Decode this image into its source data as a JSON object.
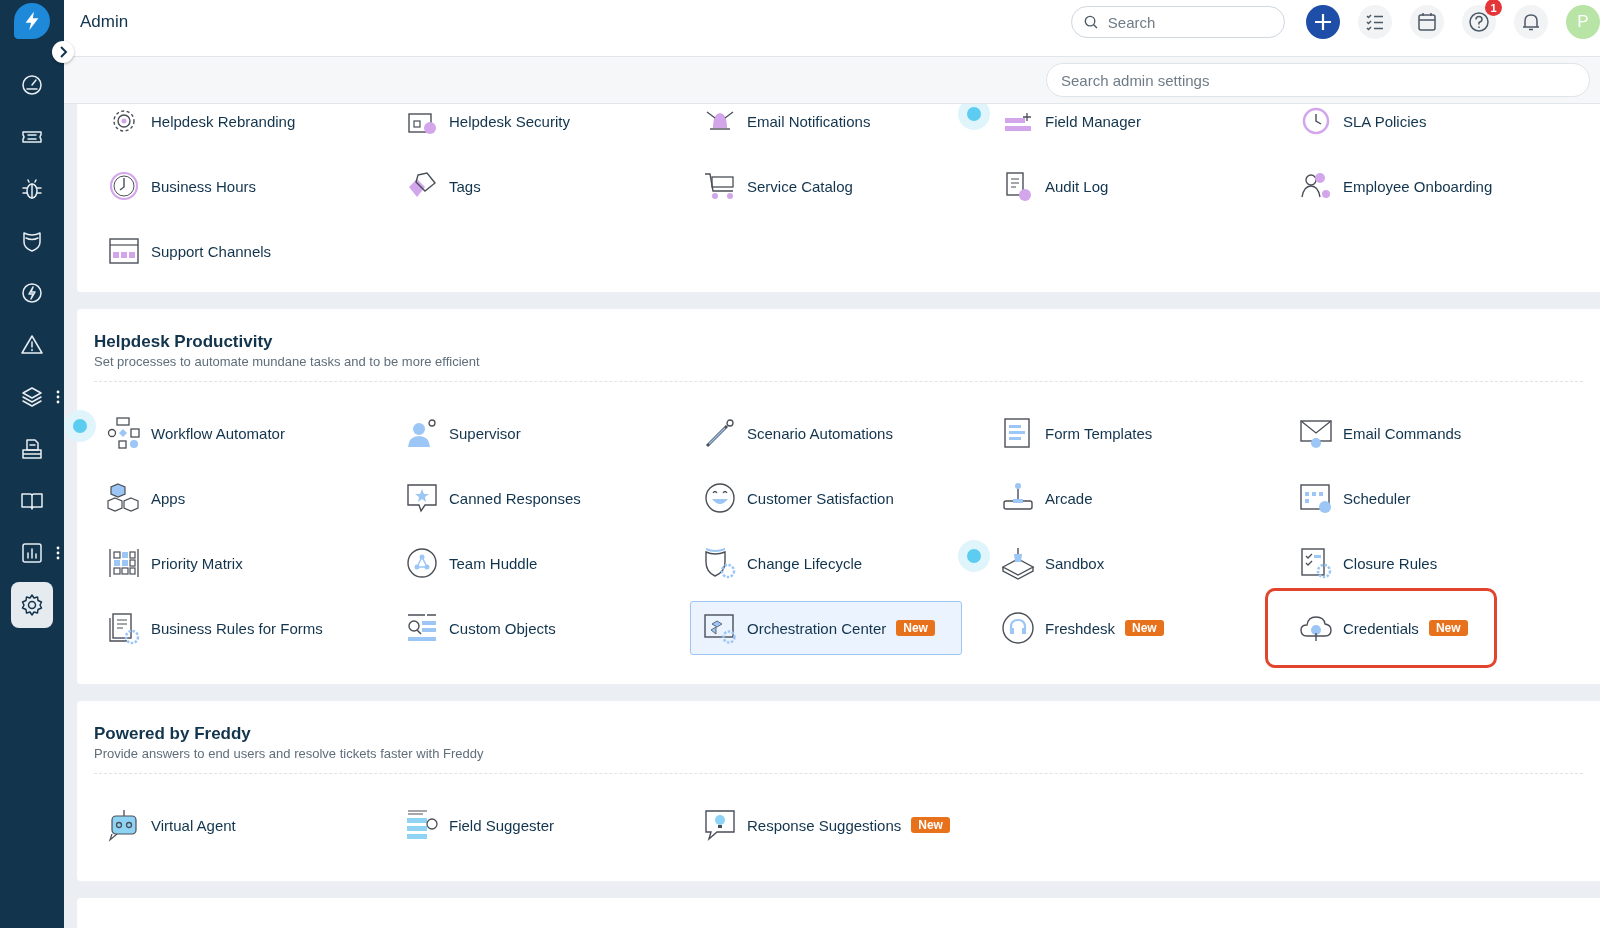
{
  "sidebar": {
    "items": [
      {
        "selected": false,
        "more": false
      },
      {
        "selected": false,
        "more": false
      },
      {
        "selected": false,
        "more": false
      },
      {
        "selected": false,
        "more": false
      },
      {
        "selected": false,
        "more": false
      },
      {
        "selected": false,
        "more": false
      },
      {
        "selected": false,
        "more": true
      },
      {
        "selected": false,
        "more": false
      },
      {
        "selected": false,
        "more": false
      },
      {
        "selected": false,
        "more": true
      },
      {
        "selected": true,
        "more": false
      }
    ]
  },
  "header": {
    "title": "Admin",
    "search": {
      "placeholder": "Search"
    },
    "help_badge": "1",
    "avatar": "P"
  },
  "admin_search": {
    "placeholder": "Search admin settings"
  },
  "sections": [
    {
      "items": [
        {
          "label": "Helpdesk Rebranding",
          "beacon": false
        },
        {
          "label": "Helpdesk Security",
          "beacon": false
        },
        {
          "label": "Email Notifications",
          "beacon": false
        },
        {
          "label": "Field Manager",
          "beacon": true
        },
        {
          "label": "SLA Policies",
          "beacon": false
        },
        {
          "label": "Business Hours",
          "beacon": false
        },
        {
          "label": "Tags",
          "beacon": false
        },
        {
          "label": "Service Catalog",
          "beacon": false
        },
        {
          "label": "Audit Log",
          "beacon": false
        },
        {
          "label": "Employee Onboarding",
          "beacon": false
        },
        {
          "label": "Support Channels",
          "beacon": false
        }
      ]
    },
    {
      "title": "Helpdesk Productivity",
      "subtitle": "Set processes to automate mundane tasks and to be more efficient",
      "items": [
        {
          "label": "Workflow Automator",
          "beacon": true,
          "hovered": false,
          "outlined": false
        },
        {
          "label": "Supervisor",
          "beacon": false,
          "hovered": false,
          "outlined": false
        },
        {
          "label": "Scenario Automations",
          "beacon": false,
          "hovered": false,
          "outlined": false
        },
        {
          "label": "Form Templates",
          "beacon": false,
          "hovered": false,
          "outlined": false
        },
        {
          "label": "Email Commands",
          "beacon": false,
          "hovered": false,
          "outlined": false
        },
        {
          "label": "Apps",
          "beacon": false,
          "hovered": false,
          "outlined": false
        },
        {
          "label": "Canned Responses",
          "beacon": false,
          "hovered": false,
          "outlined": false
        },
        {
          "label": "Customer Satisfaction",
          "beacon": false,
          "hovered": false,
          "outlined": false
        },
        {
          "label": "Arcade",
          "beacon": false,
          "hovered": false,
          "outlined": false
        },
        {
          "label": "Scheduler",
          "beacon": false,
          "hovered": false,
          "outlined": false
        },
        {
          "label": "Priority Matrix",
          "beacon": false,
          "hovered": false,
          "outlined": false
        },
        {
          "label": "Team Huddle",
          "beacon": false,
          "hovered": false,
          "outlined": false
        },
        {
          "label": "Change Lifecycle",
          "beacon": false,
          "hovered": false,
          "outlined": false
        },
        {
          "label": "Sandbox",
          "beacon": true,
          "hovered": false,
          "outlined": false
        },
        {
          "label": "Closure Rules",
          "beacon": false,
          "hovered": false,
          "outlined": false
        },
        {
          "label": "Business Rules for Forms",
          "beacon": false,
          "hovered": false,
          "outlined": false
        },
        {
          "label": "Custom Objects",
          "beacon": false,
          "hovered": false,
          "outlined": false
        },
        {
          "label": "Orchestration Center",
          "badge": "New",
          "beacon": false,
          "hovered": true,
          "outlined": false
        },
        {
          "label": "Freshdesk",
          "badge": "New",
          "beacon": false,
          "hovered": false,
          "outlined": false
        },
        {
          "label": "Credentials",
          "badge": "New",
          "beacon": false,
          "hovered": false,
          "outlined": true
        }
      ]
    },
    {
      "title": "Powered by Freddy",
      "subtitle": "Provide answers to end users and resolve tickets faster with Freddy",
      "items": [
        {
          "label": "Virtual Agent"
        },
        {
          "label": "Field Suggester"
        },
        {
          "label": "Response Suggestions",
          "badge": "New"
        }
      ]
    }
  ]
}
